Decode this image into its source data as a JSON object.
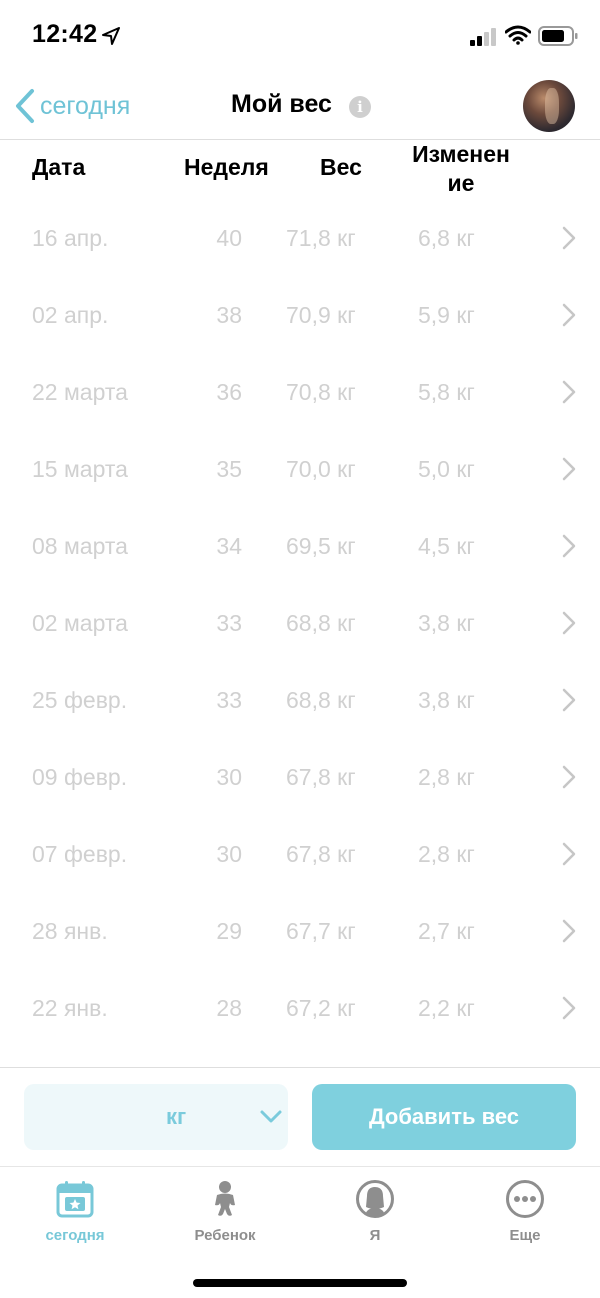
{
  "status": {
    "time": "12:42"
  },
  "nav": {
    "back_label": "сегодня",
    "title": "Мой вес",
    "info_glyph": "i"
  },
  "table": {
    "headers": {
      "date": "Дата",
      "week": "Неделя",
      "weight": "Вес",
      "change_line1": "Изменен",
      "change_line2": "ие"
    },
    "rows": [
      {
        "date": "16 апр.",
        "week": "40",
        "weight": "71,8 кг",
        "change": "6,8 кг"
      },
      {
        "date": "02 апр.",
        "week": "38",
        "weight": "70,9 кг",
        "change": "5,9 кг"
      },
      {
        "date": "22 марта",
        "week": "36",
        "weight": "70,8 кг",
        "change": "5,8 кг"
      },
      {
        "date": "15 марта",
        "week": "35",
        "weight": "70,0 кг",
        "change": "5,0 кг"
      },
      {
        "date": "08 марта",
        "week": "34",
        "weight": "69,5 кг",
        "change": "4,5 кг"
      },
      {
        "date": "02 марта",
        "week": "33",
        "weight": "68,8 кг",
        "change": "3,8 кг"
      },
      {
        "date": "25 февр.",
        "week": "33",
        "weight": "68,8 кг",
        "change": "3,8 кг"
      },
      {
        "date": "09 февр.",
        "week": "30",
        "weight": "67,8 кг",
        "change": "2,8 кг"
      },
      {
        "date": "07 февр.",
        "week": "30",
        "weight": "67,8 кг",
        "change": "2,8 кг"
      },
      {
        "date": "28 янв.",
        "week": "29",
        "weight": "67,7 кг",
        "change": "2,7 кг"
      },
      {
        "date": "22 янв.",
        "week": "28",
        "weight": "67,2 кг",
        "change": "2,2 кг"
      }
    ]
  },
  "actions": {
    "unit": "кг",
    "add_label": "Добавить вес"
  },
  "tabs": [
    {
      "label": "сегодня",
      "icon": "calendar-star-icon",
      "active": true
    },
    {
      "label": "Ребенок",
      "icon": "baby-icon",
      "active": false
    },
    {
      "label": "Я",
      "icon": "woman-icon",
      "active": false
    },
    {
      "label": "Еще",
      "icon": "more-icon",
      "active": false
    }
  ],
  "colors": {
    "accent": "#6fc3d6",
    "button": "#7fd0de",
    "row_text": "#d0d0d0",
    "tab_inactive": "#8e8e8e"
  }
}
